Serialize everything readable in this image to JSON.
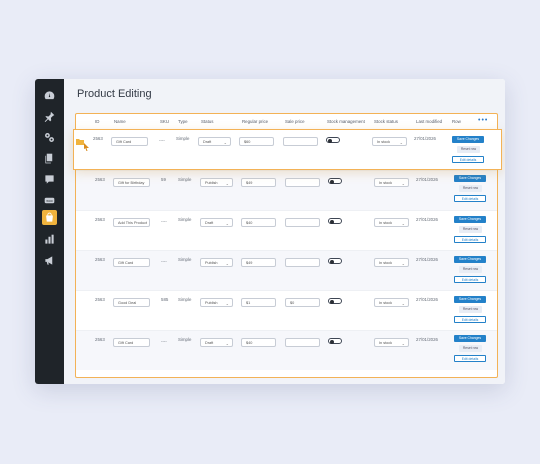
{
  "page_title": "Product Editing",
  "sidebar": {
    "items": [
      {
        "icon": "dashboard-icon"
      },
      {
        "icon": "pin-icon"
      },
      {
        "icon": "settings-cog-icon"
      },
      {
        "icon": "copy-pages-icon"
      },
      {
        "icon": "comment-icon"
      },
      {
        "icon": "woo-icon"
      },
      {
        "icon": "products-bag-icon",
        "active": true
      },
      {
        "icon": "analytics-bars-icon"
      },
      {
        "icon": "marketing-megaphone-icon"
      }
    ]
  },
  "table": {
    "headers": {
      "id": "ID",
      "name": "Name",
      "sku": "SKU",
      "type": "Type",
      "status": "Status",
      "regular_price": "Regular price",
      "sale_price": "Sale price",
      "stock_management": "Stock management",
      "stock_status": "Stock status",
      "last_modified": "Last modified",
      "row": "Row",
      "more": "•••"
    },
    "rows": [
      {
        "id": "2563",
        "name": "Gift Card",
        "sku": "----",
        "type": "Simple",
        "status": "Draft",
        "regular_price": "$60",
        "sale_price": "",
        "stock_status": "In stock",
        "last_modified": "27/01/2026",
        "btn_primary": "Save Changes",
        "btn_secondary": "Reset row",
        "btn_outline": "Edit details"
      },
      {
        "id": "2563",
        "name": "Gift for Birthday",
        "sku": "59",
        "type": "Simple",
        "status": "Publish",
        "regular_price": "$49",
        "sale_price": "",
        "stock_status": "In stock",
        "last_modified": "27/01/2026",
        "btn_primary": "Save Changes",
        "btn_secondary": "Reset row",
        "btn_outline": "Edit details"
      },
      {
        "id": "2563",
        "name": "Add This Product",
        "sku": "----",
        "type": "Simple",
        "status": "Draft",
        "regular_price": "$40",
        "sale_price": "",
        "stock_status": "In stock",
        "last_modified": "27/01/2026",
        "btn_primary": "Save Changes",
        "btn_secondary": "Reset row",
        "btn_outline": "Edit details"
      },
      {
        "id": "2563",
        "name": "Gift Card",
        "sku": "----",
        "type": "Simple",
        "status": "Publish",
        "regular_price": "$49",
        "sale_price": "",
        "stock_status": "In stock",
        "last_modified": "27/01/2026",
        "btn_primary": "Save Changes",
        "btn_secondary": "Reset row",
        "btn_outline": "Edit details"
      },
      {
        "id": "2563",
        "name": "Good Deal",
        "sku": "585",
        "type": "Simple",
        "status": "Publish",
        "regular_price": "$1",
        "sale_price": "$0",
        "stock_status": "In stock",
        "last_modified": "27/01/2026",
        "btn_primary": "Save Changes",
        "btn_secondary": "Reset row",
        "btn_outline": "Edit details"
      },
      {
        "id": "2563",
        "name": "Gift Card",
        "sku": "----",
        "type": "Simple",
        "status": "Draft",
        "regular_price": "$40",
        "sale_price": "",
        "stock_status": "In stock",
        "last_modified": "27/01/2026",
        "btn_primary": "Save Changes",
        "btn_secondary": "Reset row",
        "btn_outline": "Edit details"
      }
    ]
  },
  "colors": {
    "sidebar_bg": "#1f2429",
    "accent": "#f0b33d",
    "primary": "#2381c9"
  }
}
